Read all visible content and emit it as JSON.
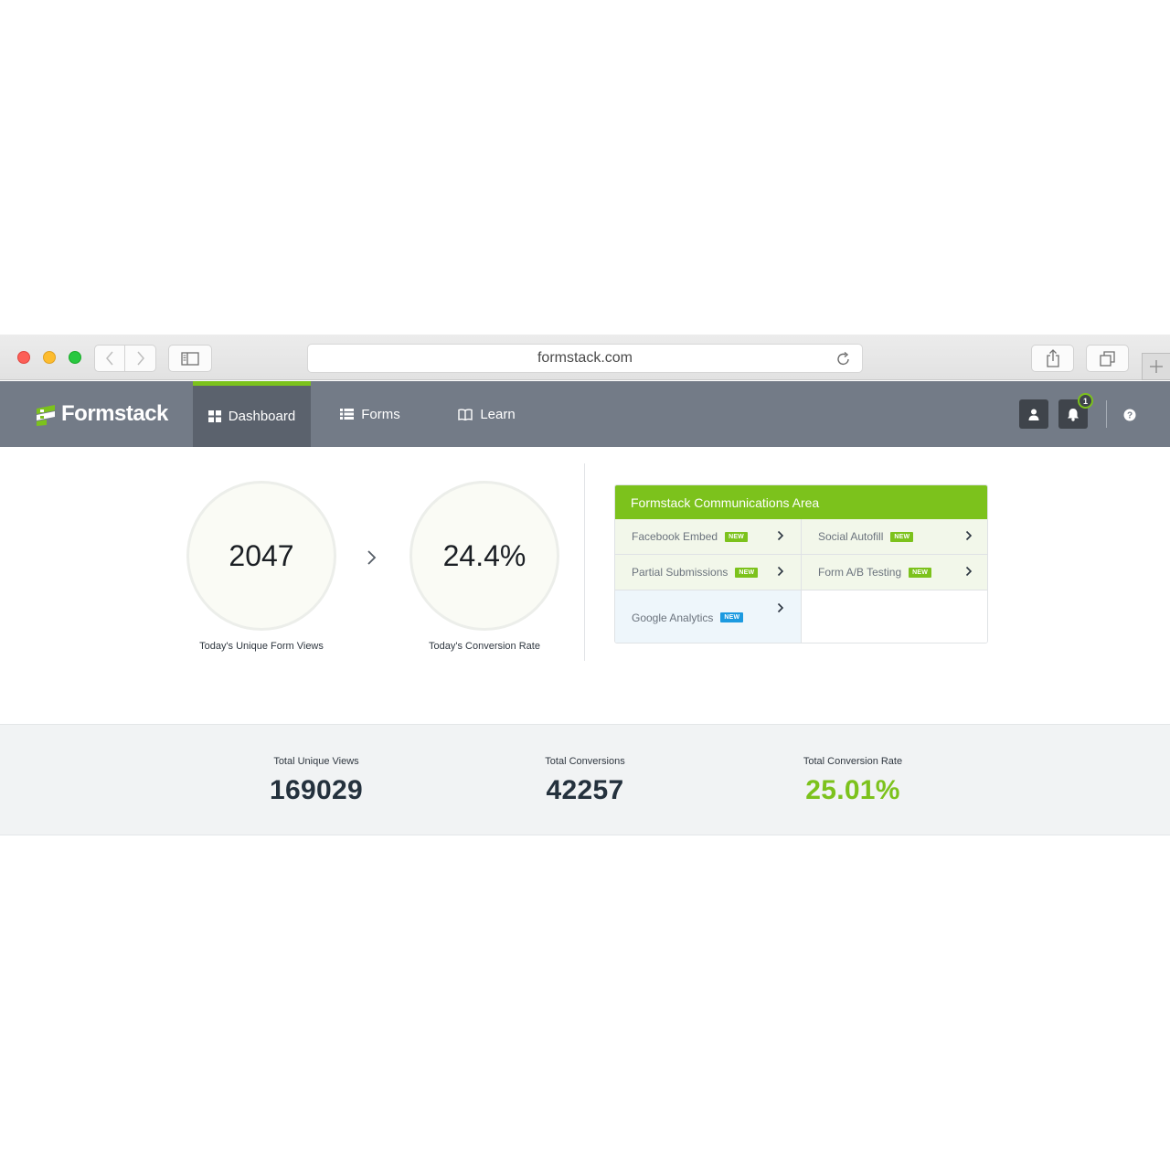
{
  "browser": {
    "url": "formstack.com"
  },
  "header": {
    "logo_text": "Formstack",
    "nav": [
      {
        "label": "Dashboard",
        "icon": "grid-icon",
        "active": true
      },
      {
        "label": "Forms",
        "icon": "list-icon",
        "active": false
      },
      {
        "label": "Learn",
        "icon": "book-icon",
        "active": false
      }
    ],
    "notification_count": "1",
    "accent_color": "#7cc21c"
  },
  "today": {
    "views_value": "2047",
    "views_label": "Today's Unique Form Views",
    "rate_value": "24.4%",
    "rate_label": "Today's Conversion Rate"
  },
  "communications": {
    "title": "Formstack Communications Area",
    "items": [
      {
        "label": "Facebook Embed",
        "badge": "NEW",
        "badge_color": "#7cc21c"
      },
      {
        "label": "Social Autofill",
        "badge": "NEW",
        "badge_color": "#7cc21c"
      },
      {
        "label": "Partial Submissions",
        "badge": "NEW",
        "badge_color": "#7cc21c"
      },
      {
        "label": "Form A/B Testing",
        "badge": "NEW",
        "badge_color": "#7cc21c"
      },
      {
        "label": "Google Analytics",
        "badge": "NEW",
        "badge_color": "#1c9ae0"
      }
    ]
  },
  "totals": {
    "views_label": "Total Unique Views",
    "views_value": "169029",
    "conversions_label": "Total Conversions",
    "conversions_value": "42257",
    "rate_label": "Total Conversion Rate",
    "rate_value": "25.01%"
  }
}
